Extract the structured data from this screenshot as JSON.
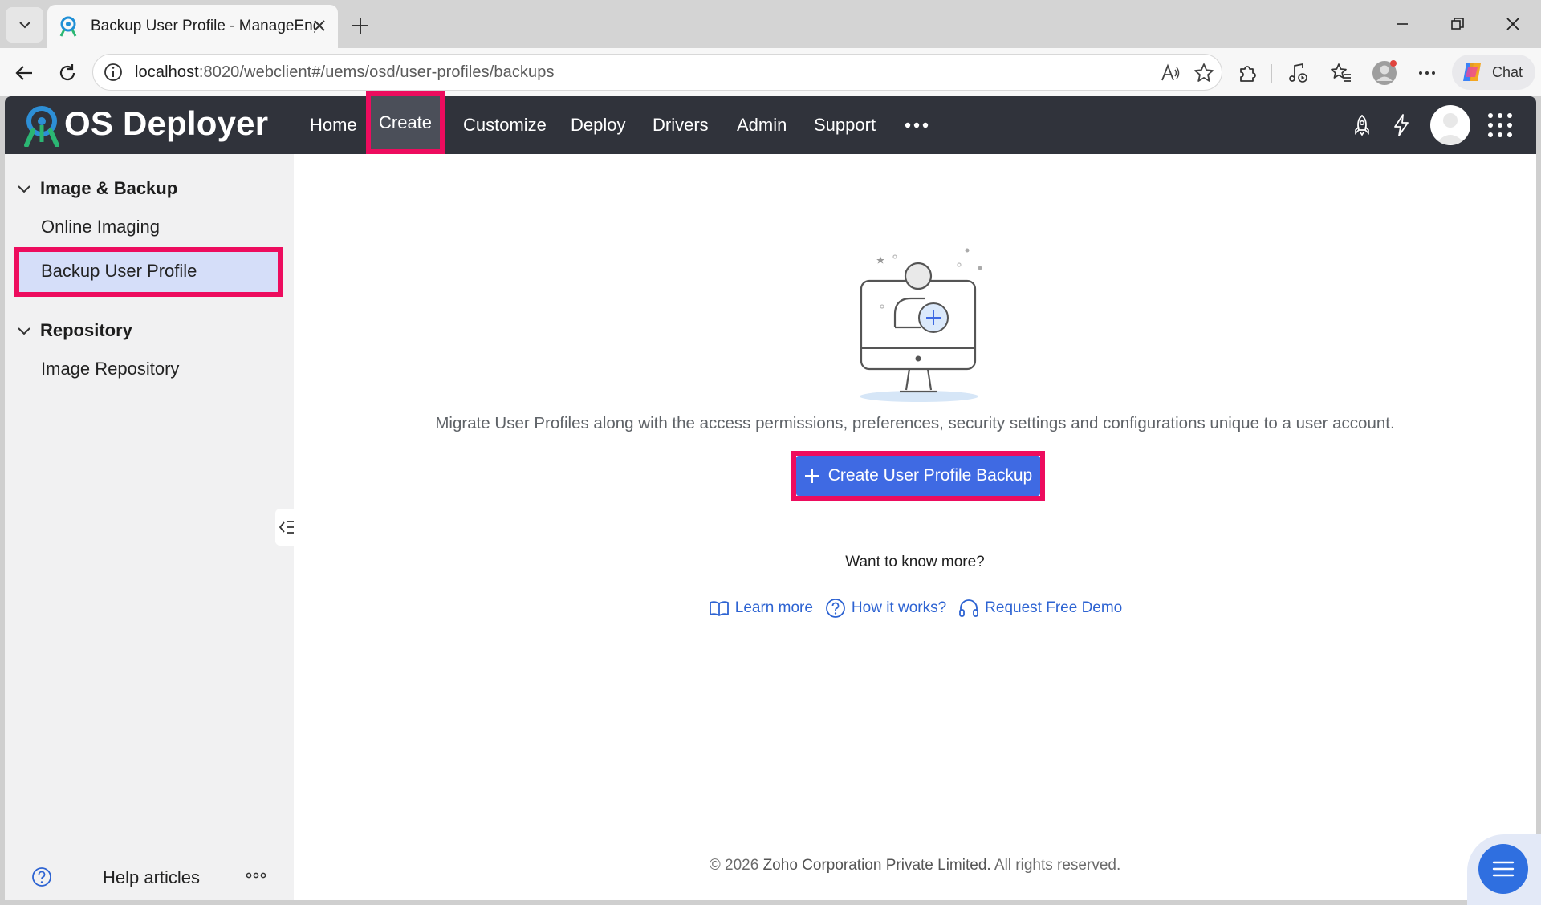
{
  "browser": {
    "tab_title": "Backup User Profile - ManageEngine",
    "url_host": "localhost",
    "url_path": ":8020/webclient#/uems/osd/user-profiles/backups",
    "chat_label": "Chat"
  },
  "app": {
    "brand": "OS Deployer",
    "nav": [
      {
        "label": "Home"
      },
      {
        "label": "Create"
      },
      {
        "label": "Customize"
      },
      {
        "label": "Deploy"
      },
      {
        "label": "Drivers"
      },
      {
        "label": "Admin"
      },
      {
        "label": "Support"
      }
    ],
    "active_nav": "Create"
  },
  "sidebar": {
    "sections": [
      {
        "title": "Image & Backup",
        "items": [
          "Online Imaging",
          "Backup User Profile"
        ]
      },
      {
        "title": "Repository",
        "items": [
          "Image Repository"
        ]
      }
    ],
    "selected_item": "Backup User Profile",
    "footer_label": "Help articles"
  },
  "main": {
    "description": "Migrate User Profiles along with the access permissions, preferences, security settings and configurations unique to a user account.",
    "cta_label": "Create User Profile Backup",
    "know_more": "Want to know more?",
    "links": [
      {
        "label": "Learn more",
        "icon": "book-icon"
      },
      {
        "label": "How it works?",
        "icon": "question-circle-icon"
      },
      {
        "label": "Request Free Demo",
        "icon": "headset-icon"
      }
    ],
    "footer": {
      "prefix": "© 2026",
      "company": "Zoho Corporation Private Limited.",
      "suffix": "All rights reserved."
    }
  },
  "colors": {
    "header_bg": "#30333b",
    "accent": "#3f6ae3",
    "highlight": "#ed0c5e",
    "sidebar_selected": "#d5def9"
  }
}
